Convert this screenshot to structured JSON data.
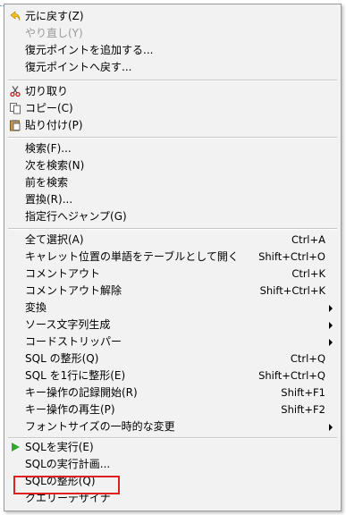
{
  "menu": {
    "items": [
      {
        "label": "元に戻す(Z)",
        "shortcut": "",
        "icon": "undo-icon",
        "enabled": true,
        "submenu": false
      },
      {
        "label": "やり直し(Y)",
        "shortcut": "",
        "icon": "",
        "enabled": false,
        "submenu": false
      },
      {
        "label": "復元ポイントを追加する...",
        "shortcut": "",
        "icon": "",
        "enabled": true,
        "submenu": false
      },
      {
        "label": "復元ポイントへ戻す...",
        "shortcut": "",
        "icon": "",
        "enabled": true,
        "submenu": false
      },
      {
        "label": "切り取り",
        "shortcut": "",
        "icon": "scissors-icon",
        "enabled": true,
        "submenu": false
      },
      {
        "label": "コピー(C)",
        "shortcut": "",
        "icon": "copy-icon",
        "enabled": true,
        "submenu": false
      },
      {
        "label": "貼り付け(P)",
        "shortcut": "",
        "icon": "paste-icon",
        "enabled": true,
        "submenu": false
      },
      {
        "label": "検索(F)...",
        "shortcut": "",
        "icon": "",
        "enabled": true,
        "submenu": false
      },
      {
        "label": "次を検索(N)",
        "shortcut": "",
        "icon": "",
        "enabled": true,
        "submenu": false
      },
      {
        "label": "前を検索",
        "shortcut": "",
        "icon": "",
        "enabled": true,
        "submenu": false
      },
      {
        "label": "置換(R)...",
        "shortcut": "",
        "icon": "",
        "enabled": true,
        "submenu": false
      },
      {
        "label": "指定行へジャンプ(G)",
        "shortcut": "",
        "icon": "",
        "enabled": true,
        "submenu": false
      },
      {
        "label": "全て選択(A)",
        "shortcut": "Ctrl+A",
        "icon": "",
        "enabled": true,
        "submenu": false
      },
      {
        "label": "キャレット位置の単語をテーブルとして開く",
        "shortcut": "Shift+Ctrl+O",
        "icon": "",
        "enabled": true,
        "submenu": false
      },
      {
        "label": "コメントアウト",
        "shortcut": "Ctrl+K",
        "icon": "",
        "enabled": true,
        "submenu": false
      },
      {
        "label": "コメントアウト解除",
        "shortcut": "Shift+Ctrl+K",
        "icon": "",
        "enabled": true,
        "submenu": false
      },
      {
        "label": "変換",
        "shortcut": "",
        "icon": "",
        "enabled": true,
        "submenu": true
      },
      {
        "label": "ソース文字列生成",
        "shortcut": "",
        "icon": "",
        "enabled": true,
        "submenu": true
      },
      {
        "label": "コードストリッパー",
        "shortcut": "",
        "icon": "",
        "enabled": true,
        "submenu": true
      },
      {
        "label": "SQL の整形(Q)",
        "shortcut": "Ctrl+Q",
        "icon": "",
        "enabled": true,
        "submenu": false
      },
      {
        "label": "SQL を1行に整形(E)",
        "shortcut": "Shift+Ctrl+Q",
        "icon": "",
        "enabled": true,
        "submenu": false
      },
      {
        "label": "キー操作の記録開始(R)",
        "shortcut": "Shift+F1",
        "icon": "",
        "enabled": true,
        "submenu": false
      },
      {
        "label": "キー操作の再生(P)",
        "shortcut": "Shift+F2",
        "icon": "",
        "enabled": true,
        "submenu": false
      },
      {
        "label": "フォントサイズの一時的な変更",
        "shortcut": "",
        "icon": "",
        "enabled": true,
        "submenu": true
      },
      {
        "label": "SQLを実行(E)",
        "shortcut": "",
        "icon": "play-icon",
        "enabled": true,
        "submenu": false
      },
      {
        "label": "SQLの実行計画...",
        "shortcut": "",
        "icon": "",
        "enabled": true,
        "submenu": false
      },
      {
        "label": "SQLの整形(Q)",
        "shortcut": "",
        "icon": "",
        "enabled": true,
        "submenu": false
      },
      {
        "label": "クエリーデザイナ",
        "shortcut": "",
        "icon": "",
        "enabled": true,
        "submenu": false
      }
    ]
  },
  "colors": {
    "menu_background": "#f2f2f2",
    "highlight_box": "#e02020",
    "play_icon": "#2eaa2e",
    "disabled_text": "#9a9a9a"
  }
}
